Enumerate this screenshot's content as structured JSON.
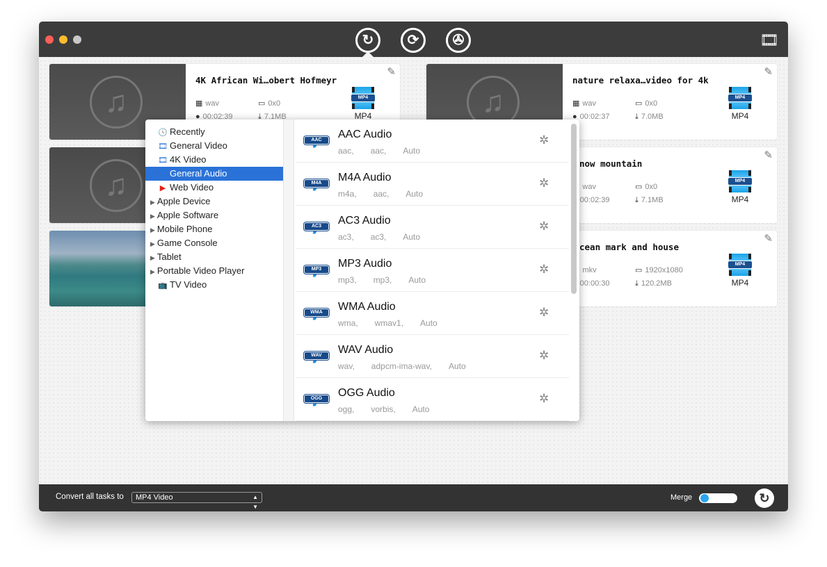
{
  "window": {
    "lights": [
      "#fc5f57",
      "#fdbc2e",
      "#c8c8c8"
    ]
  },
  "toolbar": {
    "buttons": [
      {
        "name": "convert",
        "icon": "↻"
      },
      {
        "name": "dvd",
        "icon": "⟳"
      },
      {
        "name": "media",
        "icon": "✇"
      }
    ],
    "right_icon": "🎞"
  },
  "tasks": [
    {
      "title": "4K African Wi…obert Hofmeyr",
      "format": "wav",
      "resolution": "0x0",
      "duration": "00:02:39",
      "size": "7.1MB",
      "output": "MP4",
      "thumb": "audio"
    },
    {
      "title": "nature relaxa…video for 4k",
      "format": "wav",
      "resolution": "0x0",
      "duration": "00:02:37",
      "size": "7.0MB",
      "output": "MP4",
      "thumb": "audio"
    },
    {
      "title": "",
      "thumb": "audio"
    },
    {
      "title": "now mountain",
      "format": "wav",
      "resolution": "0x0",
      "duration": "00:02:39",
      "size": "7.1MB",
      "output": "MP4"
    },
    {
      "title": "",
      "thumb": "photo"
    },
    {
      "title": "cean mark and house",
      "format": "mkv",
      "resolution": "1920x1080",
      "duration": "00:00:30",
      "size": "120.2MB",
      "output": "MP4"
    }
  ],
  "mp4_badge": "MP4",
  "categories": [
    {
      "label": "Recently",
      "icon": "clock-icon"
    },
    {
      "label": "General Video",
      "icon": "film-icon"
    },
    {
      "label": "4K Video",
      "icon": "4k-film-icon"
    },
    {
      "label": "General Audio",
      "icon": "note-icon",
      "selected": true
    },
    {
      "label": "Web Video",
      "icon": "youtube-icon"
    },
    {
      "label": "Apple Device",
      "expandable": true
    },
    {
      "label": "Apple Software",
      "expandable": true
    },
    {
      "label": "Mobile Phone",
      "expandable": true
    },
    {
      "label": "Game Console",
      "expandable": true
    },
    {
      "label": "Tablet",
      "expandable": true
    },
    {
      "label": "Portable Video Player",
      "expandable": true
    },
    {
      "label": "TV Video",
      "icon": "tv-icon"
    }
  ],
  "formats": [
    {
      "name": "AAC Audio",
      "badge": "AAC",
      "ext": "aac,",
      "codec": "aac,",
      "quality": "Auto"
    },
    {
      "name": "M4A Audio",
      "badge": "M4A",
      "ext": "m4a,",
      "codec": "aac,",
      "quality": "Auto"
    },
    {
      "name": "AC3 Audio",
      "badge": "AC3",
      "ext": "ac3,",
      "codec": "ac3,",
      "quality": "Auto"
    },
    {
      "name": "MP3 Audio",
      "badge": "MP3",
      "ext": "mp3,",
      "codec": "mp3,",
      "quality": "Auto"
    },
    {
      "name": "WMA Audio",
      "badge": "WMA",
      "ext": "wma,",
      "codec": "wmav1,",
      "quality": "Auto"
    },
    {
      "name": "WAV Audio",
      "badge": "WAV",
      "ext": "wav,",
      "codec": "adpcm-ima-wav,",
      "quality": "Auto"
    },
    {
      "name": "OGG Audio",
      "badge": "OGG",
      "ext": "ogg,",
      "codec": "vorbis,",
      "quality": "Auto"
    }
  ],
  "bottom": {
    "convert_label": "Convert all tasks to",
    "selected_format": "MP4 Video",
    "merge_label": "Merge",
    "merge_on": false
  },
  "colors": {
    "selection": "#2a72d8",
    "accent": "#2aa5f0"
  }
}
